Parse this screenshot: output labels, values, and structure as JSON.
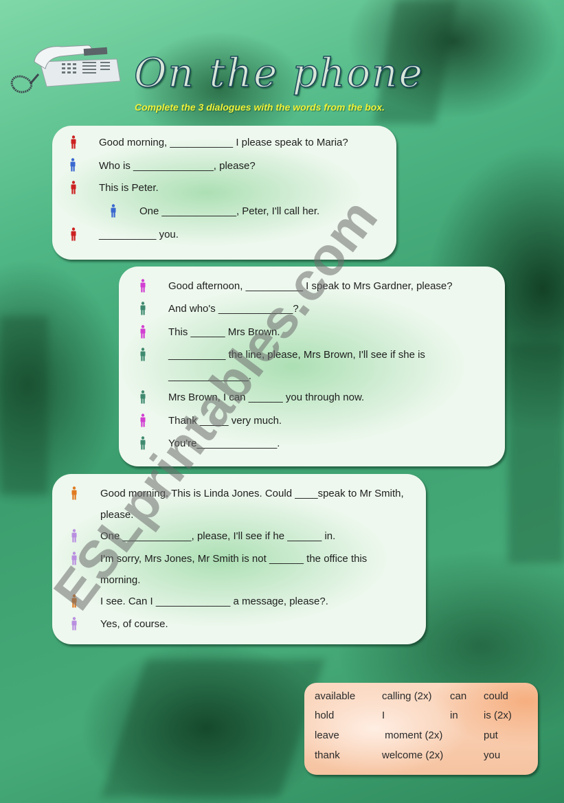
{
  "header": {
    "title": "On the phone",
    "instruction": "Complete the 3 dialogues with the words from the box."
  },
  "colors": {
    "speaker_red": "#cc2222",
    "speaker_blue": "#3a68d0",
    "speaker_magenta": "#d23fd2",
    "speaker_teal": "#3f8a70",
    "speaker_orange": "#e07a20",
    "speaker_lilac": "#b98fe0",
    "instruction_yellow": "#f2f23a"
  },
  "dialogues": [
    {
      "lines": [
        {
          "speaker": "red",
          "text": "Good morning, ___________ I please speak to Maria?"
        },
        {
          "speaker": "blue",
          "text": "Who is ______________, please?"
        },
        {
          "speaker": "red",
          "text": "This is Peter."
        },
        {
          "speaker": "blue",
          "text": "One _____________, Peter, I'll call her."
        },
        {
          "speaker": "red",
          "text": "__________ you."
        }
      ]
    },
    {
      "lines": [
        {
          "speaker": "magenta",
          "text": "Good afternoon, __________ I speak to Mrs Gardner, please?"
        },
        {
          "speaker": "teal",
          "text": "And who's _____________?"
        },
        {
          "speaker": "magenta",
          "text": "This ______ Mrs Brown."
        },
        {
          "speaker": "teal",
          "text": "__________ the line, please, Mrs Brown, I'll see if she is ______________."
        },
        {
          "speaker": "teal",
          "text": "Mrs Brown, I can ______ you through now."
        },
        {
          "speaker": "magenta",
          "text": "Thank _____ very much."
        },
        {
          "speaker": "teal",
          "text": "You're______________."
        }
      ]
    },
    {
      "lines": [
        {
          "speaker": "orange",
          "text": "Good morning. This is Linda Jones. Could ____speak to Mr Smith, please."
        },
        {
          "speaker": "lilac",
          "text": "One ____________, please, I'll see if he ______ in."
        },
        {
          "speaker": "lilac",
          "text": "I'm sorry, Mrs Jones, Mr Smith is not ______ the office this morning."
        },
        {
          "speaker": "orange",
          "text": "I see. Can I _____________ a message, please?."
        },
        {
          "speaker": "lilac",
          "text": "Yes, of course."
        }
      ]
    }
  ],
  "word_box": {
    "rows": [
      [
        "available",
        "calling  (2x)",
        "can",
        "could"
      ],
      [
        "hold",
        "I",
        "in",
        "is (2x)"
      ],
      [
        "leave",
        " moment (2x)",
        "",
        "put"
      ],
      [
        "thank",
        "welcome (2x)",
        "",
        "you"
      ]
    ]
  },
  "watermark": "ESLprintables.com"
}
